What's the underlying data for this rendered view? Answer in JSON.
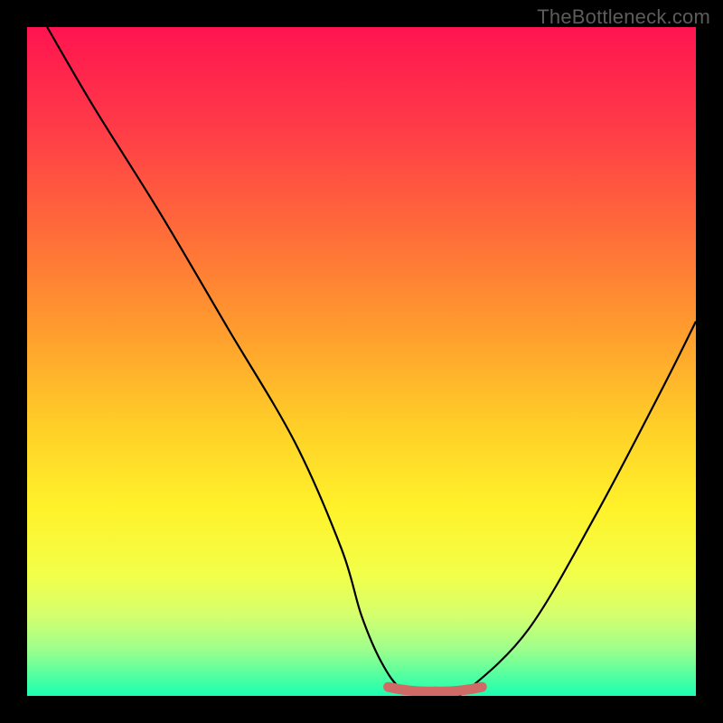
{
  "watermark": "TheBottleneck.com",
  "colors": {
    "gradient_stops": [
      {
        "offset": 0.0,
        "color": "#ff1450"
      },
      {
        "offset": 0.15,
        "color": "#ff3b48"
      },
      {
        "offset": 0.3,
        "color": "#ff6a3a"
      },
      {
        "offset": 0.45,
        "color": "#ff9b2e"
      },
      {
        "offset": 0.6,
        "color": "#ffd028"
      },
      {
        "offset": 0.72,
        "color": "#fff22a"
      },
      {
        "offset": 0.82,
        "color": "#f2ff4a"
      },
      {
        "offset": 0.88,
        "color": "#d4ff6e"
      },
      {
        "offset": 0.93,
        "color": "#9eff8c"
      },
      {
        "offset": 0.97,
        "color": "#52ffa0"
      },
      {
        "offset": 1.0,
        "color": "#1affb0"
      }
    ],
    "highlight_stroke": "#d06a66",
    "curve_stroke": "#000000",
    "frame_bg": "#000000"
  },
  "chart_data": {
    "type": "line",
    "title": "",
    "xlabel": "",
    "ylabel": "",
    "xlim": [
      0,
      100
    ],
    "ylim": [
      0,
      100
    ],
    "grid": false,
    "series": [
      {
        "name": "bottleneck-curve",
        "x": [
          3,
          10,
          20,
          30,
          40,
          47,
          50,
          53,
          56,
          60,
          63,
          66,
          75,
          85,
          95,
          100
        ],
        "values": [
          100,
          88,
          72,
          55,
          38,
          22,
          12,
          5,
          1,
          0,
          0,
          1,
          10,
          27,
          46,
          56
        ]
      }
    ],
    "annotations": [
      {
        "name": "optimal-range-highlight",
        "x_start": 54,
        "x_end": 68,
        "y": 0.8
      }
    ]
  }
}
